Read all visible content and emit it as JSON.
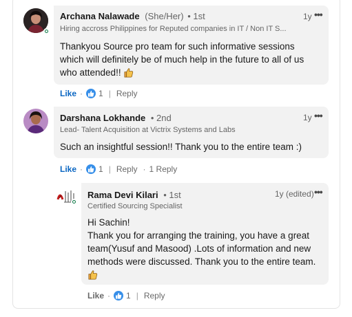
{
  "comments": [
    {
      "author": "Archana Nalawade",
      "pronouns": "(She/Her)",
      "degree": "• 1st",
      "headline": "Hiring accross Philippines for Reputed companies in IT / Non IT S...",
      "time": "1y",
      "text": "Thankyou Source pro team for such informative sessions which will definitely be of much help in the future to all of us who attended!!",
      "like_label": "Like",
      "like_count": "1",
      "reply_label": "Reply"
    },
    {
      "author": "Darshana Lokhande",
      "degree": "• 2nd",
      "headline": "Lead- Talent Acquisition at Victrix Systems and Labs",
      "time": "1y",
      "text": "Such an insightful session!! Thank you to the entire team :)",
      "like_label": "Like",
      "like_count": "1",
      "reply_label": "Reply",
      "replies_count": "1 Reply"
    },
    {
      "author": "Rama Devi Kilari",
      "degree": "• 1st",
      "headline": "Certified Sourcing Specialist",
      "time": "1y (edited)",
      "text_lines": [
        "Hi Sachin!",
        "Thank you for arranging the training, you have a great team(Yusuf and Masood) .Lots of information and new methods were discussed. Thank you to the entire team."
      ],
      "like_label": "Like",
      "like_count": "1",
      "reply_label": "Reply"
    }
  ],
  "more_glyph": "•••",
  "separator": "·",
  "colors": {
    "bubble": "#f2f2f2",
    "link_blue": "#0a66c2",
    "like_badge": "#378fe9",
    "online_green": "#057642",
    "thumbs_yellow": "#e7a33e"
  }
}
